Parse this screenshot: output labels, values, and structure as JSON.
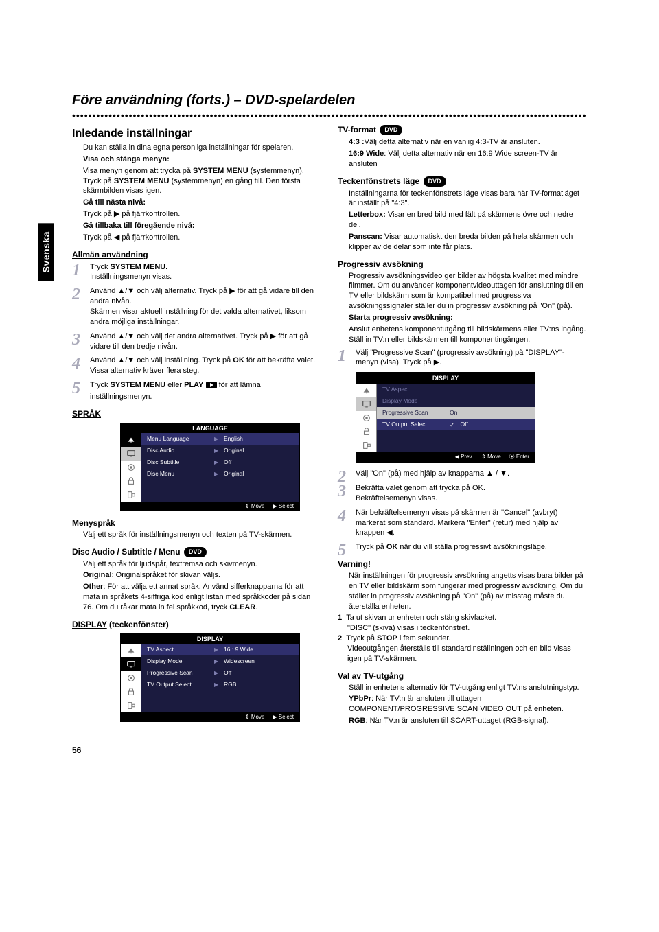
{
  "page": {
    "language_tab": "Svenska",
    "title": "Före användning (forts.) – DVD-spelardelen",
    "page_number": "56"
  },
  "dvd_badge": "DVD",
  "symbols": {
    "right": "▶",
    "left": "◀",
    "up": "▲",
    "down": "▼",
    "play": "▶",
    "updown": "▲/▼"
  },
  "left": {
    "h_inledande": "Inledande inställningar",
    "intro": "Du kan ställa in dina egna personliga inställningar för spelaren.",
    "visa_h": "Visa och stänga menyn:",
    "visa_p1a": "Visa menyn genom att trycka på ",
    "visa_p1b": "SYSTEM MENU",
    "visa_p1c": " (systemmenyn). Tryck på ",
    "visa_p1d": "SYSTEM MENU",
    "visa_p1e": " (systemmenyn) en gång till. Den första skärmbilden visas igen.",
    "ganasta_h": "Gå till nästa nivå:",
    "ganasta_p": "Tryck på ▶ på fjärrkontrollen.",
    "gatillbaka_h": "Gå tillbaka till föregående nivå:",
    "gatillbaka_p": "Tryck på ◀ på fjärrkontrollen.",
    "allman_h": "Allmän användning",
    "steps": {
      "s1a": "Tryck ",
      "s1b": "SYSTEM MENU.",
      "s1c": "Inställningsmenyn visas.",
      "s2": "Använd ▲/▼ och välj alternativ. Tryck på ▶ för att gå vidare till den andra nivån.",
      "s2b": "Skärmen visar aktuell inställning för det valda alternativet, liksom andra möjliga inställningar.",
      "s3": "Använd ▲/▼ och välj det andra alternativet. Tryck på ▶ för att gå vidare till den tredje nivån.",
      "s4a": "Använd ▲/▼ och välj inställning. Tryck på ",
      "s4b": "OK",
      "s4c": " för att bekräfta valet.",
      "s4d": "Vissa alternativ kräver flera steg.",
      "s5a": "Tryck ",
      "s5b": "SYSTEM MENU",
      "s5c": " eller ",
      "s5d": "PLAY",
      "s5e": " för att lämna inställningsmenyn."
    },
    "sprak_h": "SPRÅK",
    "menysprak_h": "Menyspråk",
    "menysprak_p": "Välj ett språk för inställningsmenyn och texten på TV-skärmen.",
    "discaudio_h": "Disc Audio / Subtitle / Menu",
    "discaudio_p1": "Välj ett språk för ljudspår, textremsa och skivmenyn.",
    "discaudio_orig_b": "Original",
    "discaudio_orig": ": Originalspråket för skivan väljs.",
    "discaudio_other_b": "Other",
    "discaudio_other": ": För att välja ett annat språk. Använd sifferknapparna för att mata in språkets 4-siffriga kod enligt listan med språkkoder på sidan 76. Om du råkar mata in fel språkkod, tryck ",
    "discaudio_clear": "CLEAR",
    "display_h": "DISPLAY",
    "display_suffix": " (teckenfönster)"
  },
  "right": {
    "tvformat_h": "TV-format",
    "tvformat_43_b": "4:3 :",
    "tvformat_43": "Välj detta alternativ när en vanlig 4:3-TV är ansluten.",
    "tvformat_169_b": "16:9 Wide",
    "tvformat_169": ": Välj detta alternativ när en 16:9 Wide screen-TV är ansluten",
    "tecken_h": "Teckenfönstrets läge",
    "tecken_p1": "Inställningarna för teckenfönstrets läge visas bara när TV-formatläget är inställt på \"4:3\".",
    "tecken_lb_b": "Letterbox:",
    "tecken_lb": " Visar en bred bild med fält på skärmens övre och nedre del.",
    "tecken_ps_b": "Panscan:",
    "tecken_ps": " Visar automatiskt den breda bilden på hela skärmen och klipper av de delar som inte får plats.",
    "prog_h": "Progressiv avsökning",
    "prog_p": "Progressiv avsökningsvideo ger bilder av högsta kvalitet med mindre flimmer. Om du använder komponentvideouttagen för anslutning till en TV eller bildskärm som är kompatibel med progressiva avsökningssignaler ställer du in progressiv avsökning på \"On\" (på).",
    "prog_start_h": "Starta progressiv avsökning:",
    "prog_start_p": "Anslut enhetens komponentutgång till bildskärmens eller TV:ns ingång. Ställ in TV:n eller bildskärmen till komponentingången.",
    "prog_steps": {
      "s1": "Välj \"Progressive Scan\" (progressiv avsökning) på \"DISPLAY\"-menyn (visa). Tryck på ▶.",
      "s2": "Välj \"On\" (på) med hjälp av knapparna ▲ / ▼.",
      "s3a": "Bekräfta valet genom att trycka på OK.",
      "s3b": "Bekräftelsemenyn visas.",
      "s4": "När bekräftelsemenyn visas på skärmen är \"Cancel\" (avbryt) markerat som standard. Markera \"Enter\" (retur) med hjälp av knappen ◀.",
      "s5a": "Tryck på ",
      "s5b": "OK",
      "s5c": " när du vill ställa progressivt avsökningsläge."
    },
    "varning_h": "Varning!",
    "varning_p": "När inställningen för progressiv avsökning angetts visas bara bilder på en TV eller bildskärm som fungerar med progressiv avsökning. Om du ställer in progressiv avsökning på \"On\" (på) av misstag måste du återställa enheten.",
    "varning_1a": "Ta ut skivan ur enheten och stäng skivfacket.",
    "varning_1b": "\"DISC\" (skiva) visas i teckenfönstret.",
    "varning_2a": "Tryck på ",
    "varning_2b": "STOP",
    "varning_2c": " i fem sekunder.",
    "varning_2d": "Videoutgången återställs till standardinställningen och en bild visas igen på TV-skärmen.",
    "tvout_h": "Val av TV-utgång",
    "tvout_p": "Ställ in enhetens alternativ för TV-utgång enligt TV:ns anslutningstyp.",
    "tvout_yp_b": "YPbPr",
    "tvout_yp": ": När TV:n är ansluten till uttagen COMPONENT/PROGRESSIVE SCAN VIDEO OUT på enheten.",
    "tvout_rgb_b": "RGB",
    "tvout_rgb": ": När TV:n är ansluten till SCART-uttaget (RGB-signal)."
  },
  "osd_lang": {
    "title": "LANGUAGE",
    "rows": [
      {
        "lab": "Menu Language",
        "val": "English"
      },
      {
        "lab": "Disc Audio",
        "val": "Original"
      },
      {
        "lab": "Disc Subtitle",
        "val": "Off"
      },
      {
        "lab": "Disc Menu",
        "val": "Original"
      }
    ],
    "foot": [
      "⇕ Move",
      "▶  Select"
    ]
  },
  "osd_disp1": {
    "title": "DISPLAY",
    "rows": [
      {
        "lab": "TV Aspect",
        "val": "16  :  9 Wide"
      },
      {
        "lab": "Display Mode",
        "val": "Widescreen"
      },
      {
        "lab": "Progressive Scan",
        "val": "Off"
      },
      {
        "lab": "TV Output Select",
        "val": "RGB"
      }
    ],
    "foot": [
      "⇕ Move",
      "▶  Select"
    ]
  },
  "osd_disp2": {
    "title": "DISPLAY",
    "rows": [
      {
        "lab": "TV Aspect",
        "val": ""
      },
      {
        "lab": "Display Mode",
        "val": ""
      },
      {
        "lab": "Progressive Scan",
        "val": "On"
      },
      {
        "lab": "TV Output Select",
        "val": "Off",
        "chk": "✓"
      }
    ],
    "foot": [
      "◀ Prev.",
      "⇕ Move",
      "⦿ Enter"
    ]
  }
}
